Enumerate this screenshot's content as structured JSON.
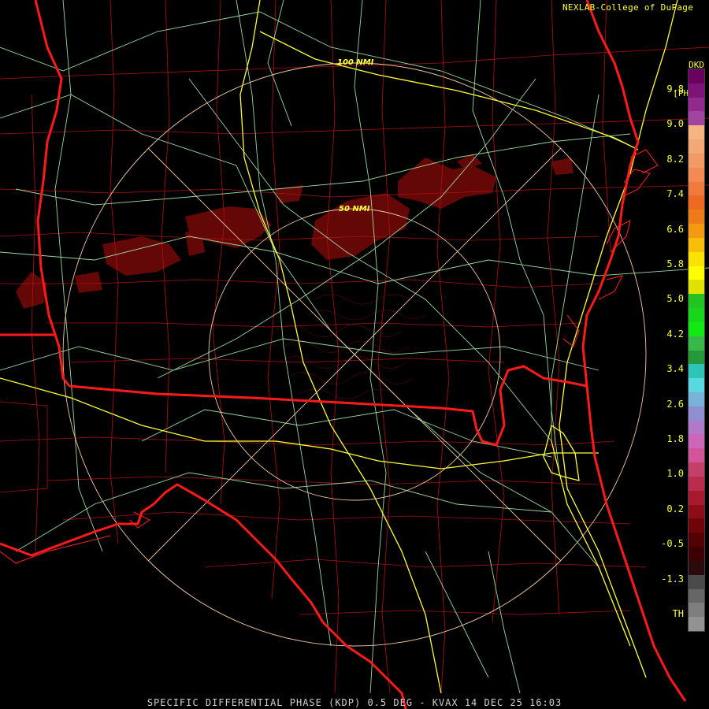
{
  "credit": "NEXLAB-College of DuPage",
  "product": {
    "unit_line1": "DKD",
    "unit_line2": "[PHAS]"
  },
  "caption": "SPECIFIC DIFFERENTIAL PHASE (KDP) 0.5 DEG - KVAX 14 DEC 25 16:03",
  "range_rings": [
    {
      "label": "100 NMI"
    },
    {
      "label": "50 NMI"
    }
  ],
  "colorbar": {
    "labels": [
      "9.8",
      "9.0",
      "8.2",
      "7.4",
      "6.6",
      "5.8",
      "5.0",
      "4.2",
      "3.4",
      "2.6",
      "1.8",
      "1.0",
      "0.2",
      "-0.5",
      "-1.3",
      "TH"
    ],
    "colors": [
      "#6a005e",
      "#7d1377",
      "#912a8c",
      "#a0449e",
      "#f6b482",
      "#f3a877",
      "#f29a66",
      "#f28a55",
      "#f07a3e",
      "#ec6a22",
      "#ee7a1a",
      "#f39a12",
      "#f7bd08",
      "#fbe203",
      "#ffff00",
      "#e2e200",
      "#22c422",
      "#19d61d",
      "#12e812",
      "#38b84a",
      "#25993a",
      "#2ec4b8",
      "#5ad8e0",
      "#7ab3d8",
      "#8f8fd0",
      "#b07ac8",
      "#cc66b8",
      "#d2559a",
      "#c44068",
      "#ba2c4e",
      "#a8182e",
      "#8c0c18",
      "#6e0408",
      "#520000",
      "#3a0000",
      "#2a0a0a",
      "#4a4a4a",
      "#666666",
      "#7e7e7e",
      "#929292"
    ]
  },
  "layers": {
    "state_border_color": "#ff1a1a",
    "county_color": "#b01010",
    "highway_color": "#ffff33",
    "road_color": "#a8f0b0",
    "ring_color": "#f0c8a0",
    "echo_color": "#6a0808"
  }
}
